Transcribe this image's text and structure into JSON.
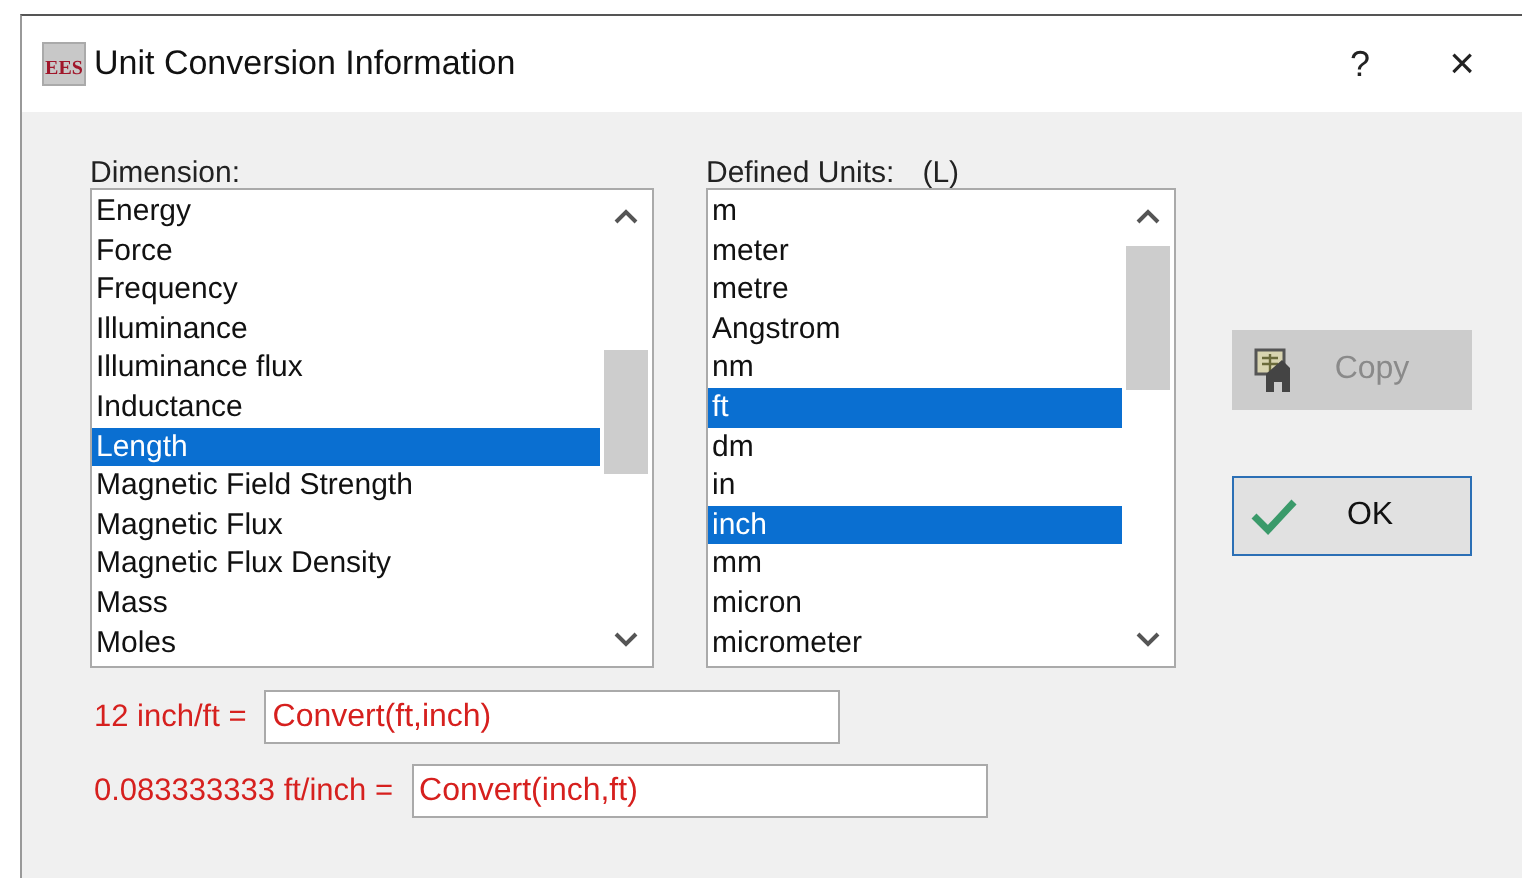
{
  "window": {
    "logo_text": "EES",
    "title": "Unit Conversion Information",
    "help": "?",
    "close": "×"
  },
  "dimension": {
    "label": "Dimension:",
    "items": [
      {
        "label": "Energy",
        "selected": false
      },
      {
        "label": "Force",
        "selected": false
      },
      {
        "label": "Frequency",
        "selected": false
      },
      {
        "label": "Illuminance",
        "selected": false
      },
      {
        "label": "Illuminance flux",
        "selected": false
      },
      {
        "label": "Inductance",
        "selected": false
      },
      {
        "label": "Length",
        "selected": true
      },
      {
        "label": "Magnetic Field Strength",
        "selected": false
      },
      {
        "label": "Magnetic Flux",
        "selected": false
      },
      {
        "label": "Magnetic Flux Density",
        "selected": false
      },
      {
        "label": "Mass",
        "selected": false
      },
      {
        "label": "Moles",
        "selected": false
      }
    ]
  },
  "units": {
    "label": "Defined Units:",
    "symbol": "(L)",
    "items": [
      {
        "label": "m",
        "selected": false
      },
      {
        "label": "meter",
        "selected": false
      },
      {
        "label": "metre",
        "selected": false
      },
      {
        "label": "Angstrom",
        "selected": false
      },
      {
        "label": "nm",
        "selected": false
      },
      {
        "label": "ft",
        "selected": true
      },
      {
        "label": "dm",
        "selected": false
      },
      {
        "label": "in",
        "selected": false
      },
      {
        "label": "inch",
        "selected": true
      },
      {
        "label": "mm",
        "selected": false
      },
      {
        "label": "micron",
        "selected": false
      },
      {
        "label": "micrometer",
        "selected": false
      }
    ]
  },
  "buttons": [
    {
      "kind": "copy",
      "label": "Copy",
      "disabled": true
    },
    {
      "kind": "ok",
      "label": "OK",
      "disabled": false
    }
  ],
  "conversions": [
    {
      "label": "12 inch/ft =",
      "value": "Convert(ft,inch)"
    },
    {
      "label": "0.083333333 ft/inch =",
      "value": "Convert(inch,ft)"
    }
  ]
}
